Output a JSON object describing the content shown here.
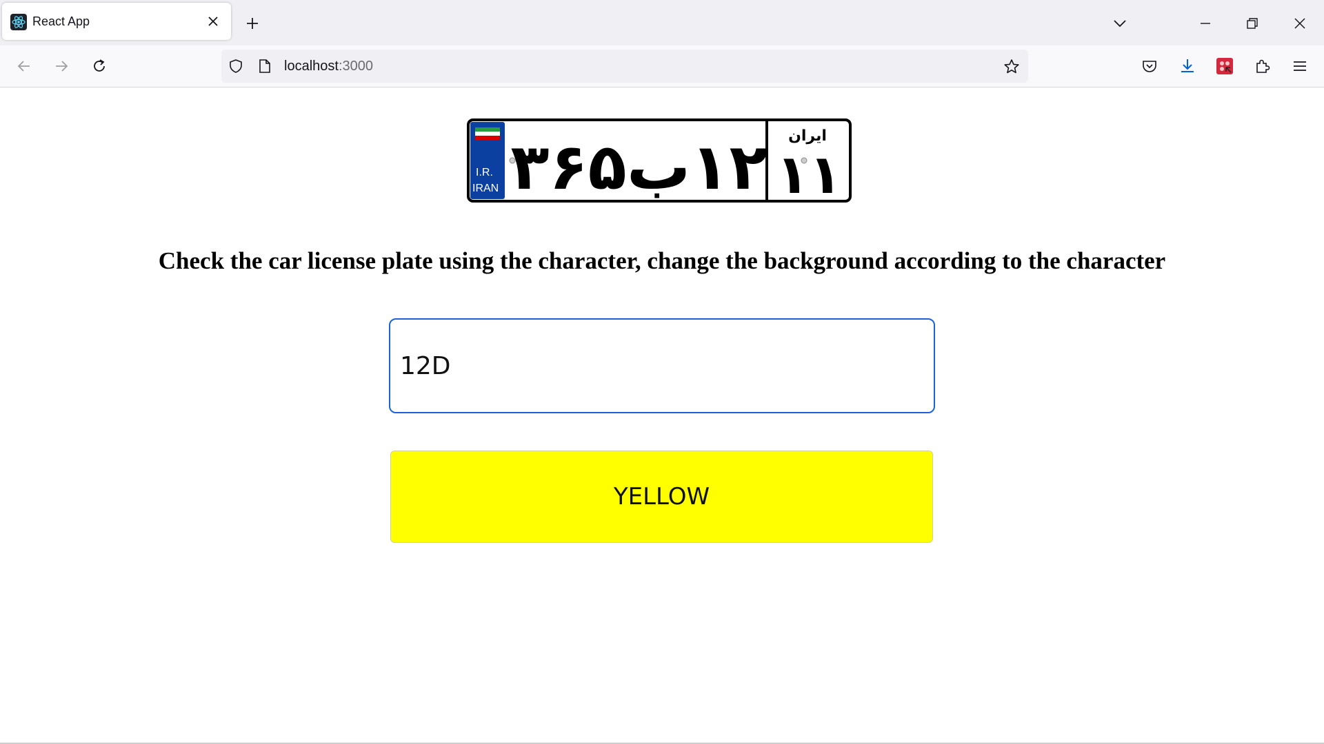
{
  "browser": {
    "tab": {
      "title": "React App",
      "favicon": "react-icon"
    },
    "url": {
      "host": "localhost",
      "port": ":3000"
    },
    "icons": [
      "back-icon",
      "forward-icon",
      "reload-icon",
      "shield-icon",
      "page-icon",
      "star-icon",
      "pocket-icon",
      "download-icon",
      "extension-icon",
      "puzzle-icon",
      "menu-icon"
    ]
  },
  "plate": {
    "country_code": "I.R.",
    "country_name": "IRAN",
    "number": "۱۲ب۳۶۵",
    "region_label": "ایران",
    "region_number": "۱۱"
  },
  "main": {
    "heading": "Check the car license plate using the character, change the background according to the character",
    "input_value": "12D",
    "result_label": "YELLOW",
    "result_color": "#ffff00"
  }
}
